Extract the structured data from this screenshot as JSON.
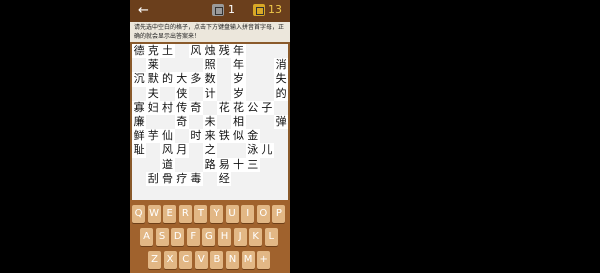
{
  "topbar": {
    "back_icon": "arrow-left-icon",
    "hint_icon": "hint-card-icon",
    "hint_count": "1",
    "coin_icon": "coin-icon",
    "coin_count": "13"
  },
  "instruction": "请先选中空白的格子，点击下方键盘输入拼音首字母，正确的就会显示出答案来！",
  "grid": [
    [
      "德",
      "克",
      "土",
      "",
      "风",
      "烛",
      "残",
      "年",
      "",
      "",
      ""
    ],
    [
      "",
      "莱",
      "",
      "",
      "",
      "照",
      "",
      "年",
      "",
      "",
      "消"
    ],
    [
      "沉",
      "默",
      "的",
      "大",
      "多",
      "数",
      "",
      "岁",
      "",
      "",
      "失"
    ],
    [
      "",
      "夫",
      "",
      "侠",
      "",
      "计",
      "",
      "岁",
      "",
      "",
      "的"
    ],
    [
      "寡",
      "妇",
      "村",
      "传",
      "奇",
      "",
      "花",
      "花",
      "公",
      "子",
      ""
    ],
    [
      "廉",
      "",
      "",
      "奇",
      "",
      "未",
      "",
      "相",
      "",
      "",
      "弹"
    ],
    [
      "鲜",
      "芋",
      "仙",
      "",
      "时",
      "来",
      "铁",
      "似",
      "金",
      "",
      ""
    ],
    [
      "耻",
      "",
      "风",
      "月",
      "",
      "之",
      "",
      "",
      "泳",
      "儿",
      ""
    ],
    [
      "",
      "",
      "道",
      "",
      "",
      "路",
      "易",
      "十",
      "三",
      "",
      ""
    ],
    [
      "",
      "刮",
      "骨",
      "疗",
      "毒",
      "",
      "经",
      "",
      "",
      "",
      ""
    ],
    [
      "",
      "",
      "",
      "",
      "",
      "",
      "",
      "",
      "",
      "",
      ""
    ]
  ],
  "keyboard": {
    "row1": [
      "Q",
      "W",
      "E",
      "R",
      "T",
      "Y",
      "U",
      "I",
      "O",
      "P"
    ],
    "row2": [
      "A",
      "S",
      "D",
      "F",
      "G",
      "H",
      "J",
      "K",
      "L"
    ],
    "row3": [
      "Z",
      "X",
      "C",
      "V",
      "B",
      "N",
      "M",
      "+"
    ]
  }
}
